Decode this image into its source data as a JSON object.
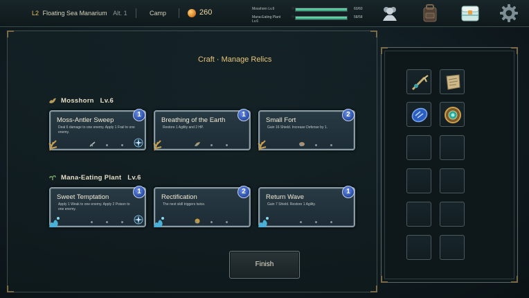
{
  "topbar": {
    "level": "L2",
    "location": "Floating Sea Manarium",
    "altitude": "Alt. 1",
    "camp": "Camp",
    "coins": "260",
    "party": [
      {
        "name": "Mosshorn Lv.6",
        "hp": "60/60",
        "hp_fraction": 1.0
      },
      {
        "name": "Mana-Eating Plant Lv.6",
        "hp": "58/58",
        "hp_fraction": 1.0
      }
    ],
    "icons": [
      "party-icon",
      "backpack-icon",
      "chest-icon",
      "gear-icon"
    ]
  },
  "title": "Craft · Manage Relics",
  "sections": [
    {
      "header": "Mosshorn   Lv.6",
      "cards": [
        {
          "name": "Moss-Antler Sweep",
          "desc": "Deal 6 damage to one enemy. Apply 1 Frail to one enemy.",
          "cost": "1"
        },
        {
          "name": "Breathing of the Earth",
          "desc": "Restore 1 Agility and 2 HP.",
          "cost": "1"
        },
        {
          "name": "Small Fort",
          "desc": "Gain 16 Shield. Increase Defense by 1.",
          "cost": "2"
        }
      ]
    },
    {
      "header": "Mana-Eating Plant   Lv.6",
      "cards": [
        {
          "name": "Sweet Temptation",
          "desc": "Apply 1 Weak to one enemy. Apply 2 Poison to one enemy.",
          "cost": "1"
        },
        {
          "name": "Rectification",
          "desc": "The next skill triggers twice.",
          "cost": "2"
        },
        {
          "name": "Return Wave",
          "desc": "Gain 7 Shield. Restore 1 Agility.",
          "cost": "1"
        }
      ]
    }
  ],
  "finish": "Finish",
  "relics": {
    "slots": [
      "antler-staff-icon",
      "scroll-icon",
      "blue-crystal-icon",
      "ornate-amulet-icon",
      "",
      "",
      "",
      "",
      "",
      "",
      "",
      ""
    ]
  }
}
